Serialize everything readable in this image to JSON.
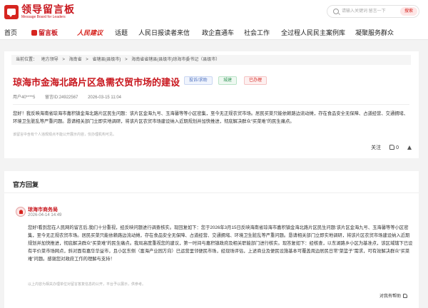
{
  "header": {
    "logo_title": "领导留言板",
    "logo_sub": "Message Board for Leaders",
    "search_placeholder": "请输入关键词 留言一下",
    "search_button": "搜索"
  },
  "nav": [
    {
      "label": "首页"
    },
    {
      "label": "留言板"
    },
    {
      "label": "人民建议"
    },
    {
      "label": "话题"
    },
    {
      "label": "人民日报读者来信"
    },
    {
      "label": "政企直通车"
    },
    {
      "label": "社会工作"
    },
    {
      "label": "全过程人民民主案例库"
    },
    {
      "label": "凝聚服务群众"
    }
  ],
  "breadcrumb": {
    "items": [
      "当前位置：",
      "地方领导",
      ">",
      "海南省",
      ">",
      "省辖县(县级市)",
      ">",
      "海南省省辖县(县级市)琼海市委书记（县级市）"
    ]
  },
  "post": {
    "title": "琼海市金海北路片区急需农贸市场的建设",
    "tags": [
      "投诉/求助",
      "城建",
      "已办理"
    ],
    "author": "用户40****5",
    "id": "留言ID:24922567",
    "time": "2026-03-15 11:04",
    "body": "您好！我反映海南省琼海市嘉积镇金海北路片区民生问题：该片区金海九号、玉海馨等等小区密集，至今无正规农贸市场。居民买菜只能依赖路边流动摊，存在食品安全无保障、占道经营、交通拥堵、环境卫生脏乱等严重问题。恳请相关部门立即实地调研，将该片区农贸市场建设纳入近期规划并加快推进，彻底解决群众“买菜难”的民生痛点。",
    "disclaimer": "该留言中含有个人违规观点不能公开展示内容，仅办理机构可见。",
    "follow": "关注",
    "like_count": "0"
  },
  "reply": {
    "heading": "官方回复",
    "org": "琼海市商务局",
    "date": "2026-04-14 14:49",
    "body": "您好!看到您在人民网的留言后,我们十分重视，经反映问题进行调查核实。现回复如下：您于2026年3月15日反映海南省琼海市嘉积镇金海北路片区民生问题:该片区金海九号、玉海馨等等小区密集，至今无正规农贸市场。居民买菜只能依赖路边流动摊，存在食品安全无保障、占道经营、交通拥堵、环境卫生脏乱等严重问题。恳请相关部门立即实地调研，将该片区农贸市场建设纳入近期规划并加快推进，彻底解决群众“买菜难”的民生痛点。我局高度重视您的建议，第一时间与嘉积镇政府及相关职能部门进行核实。现答复如下：经核查，以东湖路乡小区为基准点，该区域辖下已设有平价菜市场网点，斜对面有嘉华华益市，且小区东侧（富海产业园方向）已运营里邻便民市场，经现场评估，上述商业及便民设施基本可覆盖周边居民日常“菜篮子”需求，可有效解决群众“买菜难”问题。感谢您对政府工作的理解与支持！",
    "disclaimer": "以上内容为相关办理单位对留言答复信息的公开，平台予以展示，供参考。",
    "helpful": "对我有帮助"
  }
}
